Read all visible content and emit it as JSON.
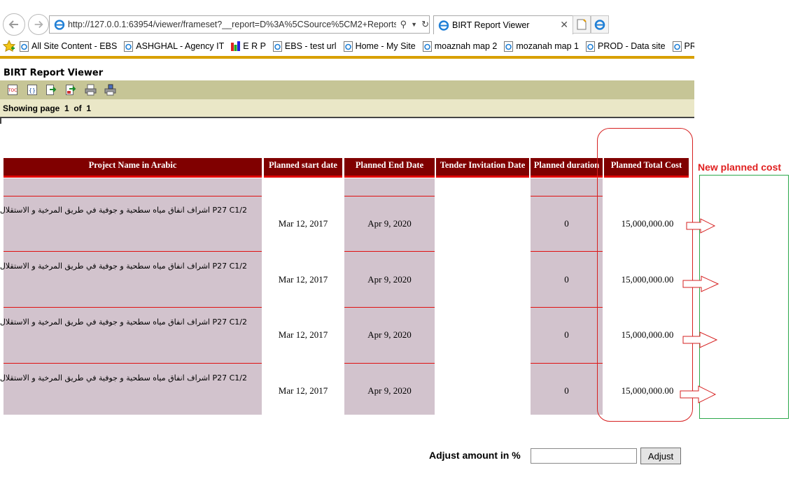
{
  "browser": {
    "url": "http://127.0.0.1:63954/viewer/frameset?__report=D%3A%5CSource%5CM2+Reports%5C",
    "tab_title": "BIRT Report Viewer",
    "favorites": [
      "All Site Content - EBS",
      "ASHGHAL - Agency IT",
      "E R P",
      "EBS - test url",
      "Home - My Site",
      "moaznah map 2",
      "mozanah map 1",
      "PROD - Data site",
      "PROD - Mo"
    ]
  },
  "viewer": {
    "title": "BIRT Report Viewer",
    "toolbar_icons": [
      "toc-icon",
      "parameters-icon",
      "export-data-icon",
      "export-report-icon",
      "print-icon",
      "print-server-icon"
    ],
    "page_status": "Showing page  1  of  1"
  },
  "report": {
    "columns": [
      "Project Name in Arabic",
      "Planned start date",
      "Planned End Date",
      "Tender Invitation Date",
      "Planned duration",
      "Planned Total Cost"
    ],
    "rows": [
      {
        "project": "P27 C1/2 اشراف انفاق مياه سطحية و جوفية في طريق المرخية و الاستقلال",
        "start": "Mar 12, 2017",
        "end": "Apr 9, 2020",
        "tender": "",
        "duration": "0",
        "cost": "15,000,000.00"
      },
      {
        "project": "P27 C1/2 اشراف انفاق مياه سطحية و جوفية في طريق المرخية و الاستقلال",
        "start": "Mar 12, 2017",
        "end": "Apr 9, 2020",
        "tender": "",
        "duration": "0",
        "cost": "15,000,000.00"
      },
      {
        "project": "P27 C1/2 اشراف انفاق مياه سطحية و جوفية في طريق المرخية و الاستقلال",
        "start": "Mar 12, 2017",
        "end": "Apr 9, 2020",
        "tender": "",
        "duration": "0",
        "cost": "15,000,000.00"
      },
      {
        "project": "P27 C1/2 اشراف انفاق مياه سطحية و جوفية في طريق المرخية و الاستقلال",
        "start": "Mar 12, 2017",
        "end": "Apr 9, 2020",
        "tender": "",
        "duration": "0",
        "cost": "15,000,000.00"
      }
    ]
  },
  "annotation": {
    "label": "New planned cost"
  },
  "adjust": {
    "label": "Adjust amount in %",
    "input_value": "",
    "button_label": "Adjust"
  },
  "colors": {
    "header_bg": "#800000",
    "column_shade": "#d2c3cd",
    "toolbar_bg": "#c6c596",
    "annotation_red": "#e02020",
    "annotation_green": "#2ba84a"
  }
}
